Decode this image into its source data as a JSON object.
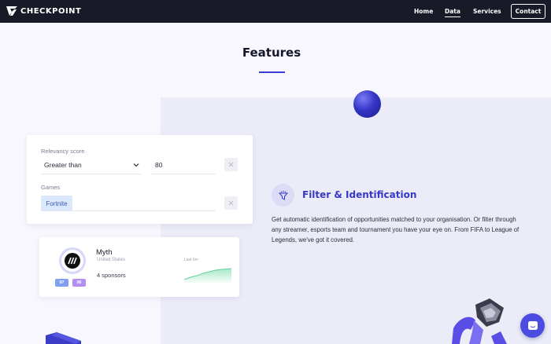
{
  "nav": {
    "brand": "CHECKPOINT",
    "links": [
      "Home",
      "Data",
      "Services"
    ],
    "active": "Data",
    "contact": "Contact"
  },
  "section": {
    "title": "Features"
  },
  "filter": {
    "relevancy_label": "Relevancy score",
    "operator": "Greater than",
    "value": "80",
    "games_label": "Games",
    "game_tag": "Fortnite"
  },
  "player": {
    "name": "Myth",
    "country": "United States",
    "sponsors": "4 sponsors",
    "badges": [
      "97",
      "96"
    ],
    "trend_label": "Last 6m"
  },
  "feature": {
    "title": "Filter & Identification",
    "description": "Get automatic identification of opportunities matched to your organisation. Or filter through any streamer, esports team and tournament you have your eye on. From FIFA to League of Legends, we've got it covered."
  },
  "colors": {
    "nav_bg": "#181b27",
    "accent": "#3538c8",
    "page_bg": "#f7f7fd",
    "band_bg": "#ececf8",
    "tag_bg": "#dbe7fb",
    "badge_blue": "#7f9ff0",
    "badge_purple": "#b28ff0",
    "spark_green": "#5fd39a"
  },
  "icons": {
    "brand": "checkpoint-logo",
    "select": "chevron-down-icon",
    "remove": "close-icon",
    "feature": "filter-funnel-icon",
    "chat": "chat-icon"
  }
}
